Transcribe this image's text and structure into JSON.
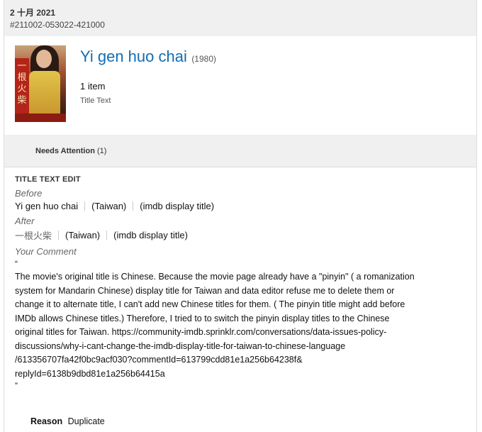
{
  "header": {
    "date": "2 十月 2021",
    "submission_id": "#211002-053022-421000"
  },
  "title_block": {
    "name": "Yi gen huo chai",
    "year": "(1980)",
    "item_count": "1 item",
    "item_type": "Title Text"
  },
  "attention": {
    "label": "Needs Attention",
    "count": "(1)"
  },
  "edit": {
    "section_title": "TITLE TEXT EDIT",
    "before_label": "Before",
    "before": {
      "title": "Yi gen huo chai",
      "region": "(Taiwan)",
      "attribute": "(imdb display title)"
    },
    "after_label": "After",
    "after": {
      "title": "一根火柴",
      "region": "(Taiwan)",
      "attribute": "(imdb display title)"
    },
    "comment_label": "Your Comment",
    "open_quote": "“",
    "comment_lines": [
      "The movie's original title is Chinese. Because the movie page already have a \"pinyin\" ( a romanization",
      "system for Mandarin Chinese) display title for Taiwan and data editor refuse me to delete them or",
      "change it to alternate title, I can't add new Chinese titles for them. ( The pinyin title might add before",
      "IMDb allows Chinese titles.) Therefore, I tried to to switch the pinyin display titles to the Chinese",
      "original titles for Taiwan. https://community-imdb.sprinklr.com/conversations/data-issues-policy-",
      "discussions/why-i-cant-change-the-imdb-display-title-for-taiwan-to-chinese-language",
      "/613356707fa42f0bc9acf030?commentId=613799cdd81e1a256b64238f&",
      "replyId=6138b9dbd81e1a256b64415a"
    ],
    "close_quote": "”"
  },
  "reason": {
    "label": "Reason",
    "value": "Duplicate"
  },
  "icons": {
    "poster": "movie-poster-image"
  }
}
